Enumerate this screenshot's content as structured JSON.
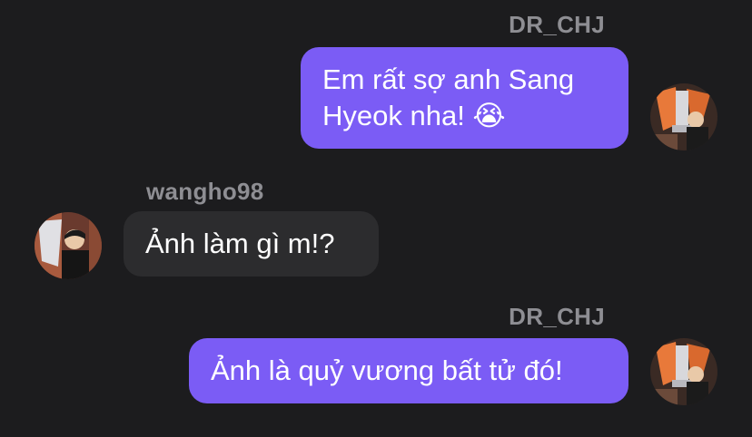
{
  "messages": [
    {
      "sender": "DR_CHJ",
      "direction": "outgoing",
      "text_line1": "Em rất sợ anh Sang",
      "text_line2": "Hyeok nha! 😭",
      "avatar": "trophy-player-avatar"
    },
    {
      "sender": "wangho98",
      "direction": "incoming",
      "text": "Ảnh làm gì m!?",
      "avatar": "player-avatar"
    },
    {
      "sender": "DR_CHJ",
      "direction": "outgoing",
      "text": "Ảnh là quỷ vương bất tử đó!",
      "avatar": "trophy-player-avatar"
    }
  ],
  "colors": {
    "background": "#1c1c1e",
    "outgoing_bubble": "#7b5cf5",
    "incoming_bubble": "#2c2c2e",
    "sender_name": "#8e8e93"
  }
}
